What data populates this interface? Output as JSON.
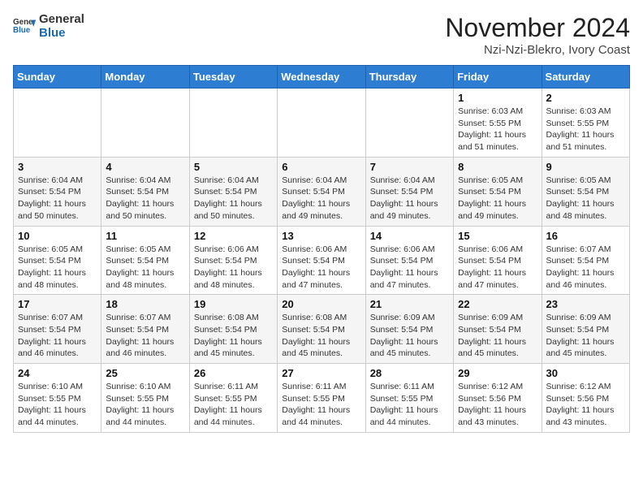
{
  "header": {
    "logo_general": "General",
    "logo_blue": "Blue",
    "month_title": "November 2024",
    "location": "Nzi-Nzi-Blekro, Ivory Coast"
  },
  "weekdays": [
    "Sunday",
    "Monday",
    "Tuesday",
    "Wednesday",
    "Thursday",
    "Friday",
    "Saturday"
  ],
  "weeks": [
    {
      "days": [
        {
          "num": "",
          "info": ""
        },
        {
          "num": "",
          "info": ""
        },
        {
          "num": "",
          "info": ""
        },
        {
          "num": "",
          "info": ""
        },
        {
          "num": "",
          "info": ""
        },
        {
          "num": "1",
          "info": "Sunrise: 6:03 AM\nSunset: 5:55 PM\nDaylight: 11 hours\nand 51 minutes."
        },
        {
          "num": "2",
          "info": "Sunrise: 6:03 AM\nSunset: 5:55 PM\nDaylight: 11 hours\nand 51 minutes."
        }
      ]
    },
    {
      "days": [
        {
          "num": "3",
          "info": "Sunrise: 6:04 AM\nSunset: 5:54 PM\nDaylight: 11 hours\nand 50 minutes."
        },
        {
          "num": "4",
          "info": "Sunrise: 6:04 AM\nSunset: 5:54 PM\nDaylight: 11 hours\nand 50 minutes."
        },
        {
          "num": "5",
          "info": "Sunrise: 6:04 AM\nSunset: 5:54 PM\nDaylight: 11 hours\nand 50 minutes."
        },
        {
          "num": "6",
          "info": "Sunrise: 6:04 AM\nSunset: 5:54 PM\nDaylight: 11 hours\nand 49 minutes."
        },
        {
          "num": "7",
          "info": "Sunrise: 6:04 AM\nSunset: 5:54 PM\nDaylight: 11 hours\nand 49 minutes."
        },
        {
          "num": "8",
          "info": "Sunrise: 6:05 AM\nSunset: 5:54 PM\nDaylight: 11 hours\nand 49 minutes."
        },
        {
          "num": "9",
          "info": "Sunrise: 6:05 AM\nSunset: 5:54 PM\nDaylight: 11 hours\nand 48 minutes."
        }
      ]
    },
    {
      "days": [
        {
          "num": "10",
          "info": "Sunrise: 6:05 AM\nSunset: 5:54 PM\nDaylight: 11 hours\nand 48 minutes."
        },
        {
          "num": "11",
          "info": "Sunrise: 6:05 AM\nSunset: 5:54 PM\nDaylight: 11 hours\nand 48 minutes."
        },
        {
          "num": "12",
          "info": "Sunrise: 6:06 AM\nSunset: 5:54 PM\nDaylight: 11 hours\nand 48 minutes."
        },
        {
          "num": "13",
          "info": "Sunrise: 6:06 AM\nSunset: 5:54 PM\nDaylight: 11 hours\nand 47 minutes."
        },
        {
          "num": "14",
          "info": "Sunrise: 6:06 AM\nSunset: 5:54 PM\nDaylight: 11 hours\nand 47 minutes."
        },
        {
          "num": "15",
          "info": "Sunrise: 6:06 AM\nSunset: 5:54 PM\nDaylight: 11 hours\nand 47 minutes."
        },
        {
          "num": "16",
          "info": "Sunrise: 6:07 AM\nSunset: 5:54 PM\nDaylight: 11 hours\nand 46 minutes."
        }
      ]
    },
    {
      "days": [
        {
          "num": "17",
          "info": "Sunrise: 6:07 AM\nSunset: 5:54 PM\nDaylight: 11 hours\nand 46 minutes."
        },
        {
          "num": "18",
          "info": "Sunrise: 6:07 AM\nSunset: 5:54 PM\nDaylight: 11 hours\nand 46 minutes."
        },
        {
          "num": "19",
          "info": "Sunrise: 6:08 AM\nSunset: 5:54 PM\nDaylight: 11 hours\nand 45 minutes."
        },
        {
          "num": "20",
          "info": "Sunrise: 6:08 AM\nSunset: 5:54 PM\nDaylight: 11 hours\nand 45 minutes."
        },
        {
          "num": "21",
          "info": "Sunrise: 6:09 AM\nSunset: 5:54 PM\nDaylight: 11 hours\nand 45 minutes."
        },
        {
          "num": "22",
          "info": "Sunrise: 6:09 AM\nSunset: 5:54 PM\nDaylight: 11 hours\nand 45 minutes."
        },
        {
          "num": "23",
          "info": "Sunrise: 6:09 AM\nSunset: 5:54 PM\nDaylight: 11 hours\nand 45 minutes."
        }
      ]
    },
    {
      "days": [
        {
          "num": "24",
          "info": "Sunrise: 6:10 AM\nSunset: 5:55 PM\nDaylight: 11 hours\nand 44 minutes."
        },
        {
          "num": "25",
          "info": "Sunrise: 6:10 AM\nSunset: 5:55 PM\nDaylight: 11 hours\nand 44 minutes."
        },
        {
          "num": "26",
          "info": "Sunrise: 6:11 AM\nSunset: 5:55 PM\nDaylight: 11 hours\nand 44 minutes."
        },
        {
          "num": "27",
          "info": "Sunrise: 6:11 AM\nSunset: 5:55 PM\nDaylight: 11 hours\nand 44 minutes."
        },
        {
          "num": "28",
          "info": "Sunrise: 6:11 AM\nSunset: 5:55 PM\nDaylight: 11 hours\nand 44 minutes."
        },
        {
          "num": "29",
          "info": "Sunrise: 6:12 AM\nSunset: 5:56 PM\nDaylight: 11 hours\nand 43 minutes."
        },
        {
          "num": "30",
          "info": "Sunrise: 6:12 AM\nSunset: 5:56 PM\nDaylight: 11 hours\nand 43 minutes."
        }
      ]
    }
  ]
}
